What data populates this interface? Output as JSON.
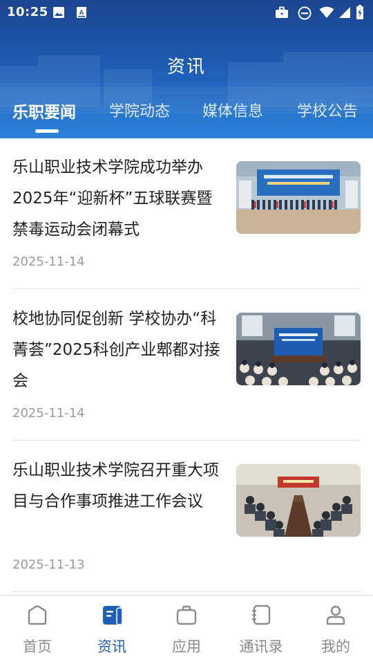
{
  "status_bar": {
    "time": "10:25",
    "left_icons": [
      "image-icon",
      "text-icon"
    ],
    "right_icons": [
      "briefcase-icon",
      "dnd-icon",
      "wifi-icon",
      "signal-icon",
      "battery-icon"
    ]
  },
  "header": {
    "title": "资讯",
    "background_color": "#1e63bd"
  },
  "tabs": [
    {
      "label": "乐职要闻",
      "active": true
    },
    {
      "label": "学院动态",
      "active": false
    },
    {
      "label": "媒体信息",
      "active": false
    },
    {
      "label": "学校公告",
      "active": false
    }
  ],
  "news": [
    {
      "title": "乐山职业技术学院成功举办2025年“迎新杯”五球联赛暨禁毒运动会闭幕式",
      "date": "2025-11-14",
      "thumbnail": "gym-ceremony-photo"
    },
    {
      "title": "校地协同促创新  学校协办“科菁荟”2025科创产业郫都对接会",
      "date": "2025-11-14",
      "thumbnail": "conference-hall-photo"
    },
    {
      "title": "乐山职业技术学院召开重大项目与合作事项推进工作会议",
      "date": "2025-11-13",
      "thumbnail": "meeting-room-photo"
    }
  ],
  "bottom_nav": [
    {
      "label": "首页",
      "icon": "home-icon",
      "active": false
    },
    {
      "label": "资讯",
      "icon": "news-icon",
      "active": true
    },
    {
      "label": "应用",
      "icon": "apps-icon",
      "active": false
    },
    {
      "label": "通讯录",
      "icon": "contacts-icon",
      "active": false
    },
    {
      "label": "我的",
      "icon": "profile-icon",
      "active": false
    }
  ],
  "colors": {
    "accent": "#1e5fb8",
    "inactive_nav": "#8a8a8a",
    "date_text": "#9a9a9a"
  }
}
